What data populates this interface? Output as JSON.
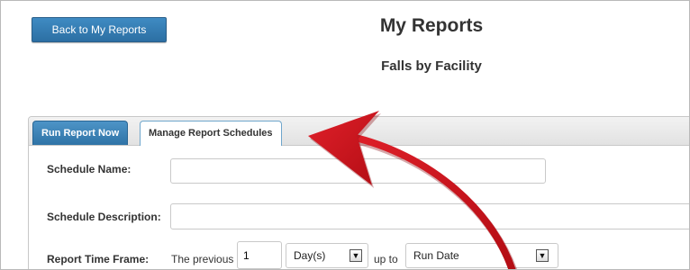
{
  "header": {
    "back_button": "Back to My Reports",
    "title": "My Reports",
    "subtitle": "Falls by Facility"
  },
  "tabs": {
    "run_now": "Run Report Now",
    "manage": "Manage Report Schedules"
  },
  "form": {
    "schedule_name_label": "Schedule Name:",
    "schedule_name_value": "",
    "schedule_description_label": "Schedule Description:",
    "schedule_description_value": "",
    "time_frame_label": "Report Time Frame:",
    "the_previous": "The previous",
    "number_value": "1",
    "unit_selected": "Day(s)",
    "up_to": "up to",
    "end_selected": "Run Date"
  },
  "icons": {
    "dropdown": "chevron-down-icon",
    "annotation": "curved-arrow-icon"
  },
  "colors": {
    "button_blue": "#2c6fa3",
    "annotation_red": "#d3141b"
  }
}
